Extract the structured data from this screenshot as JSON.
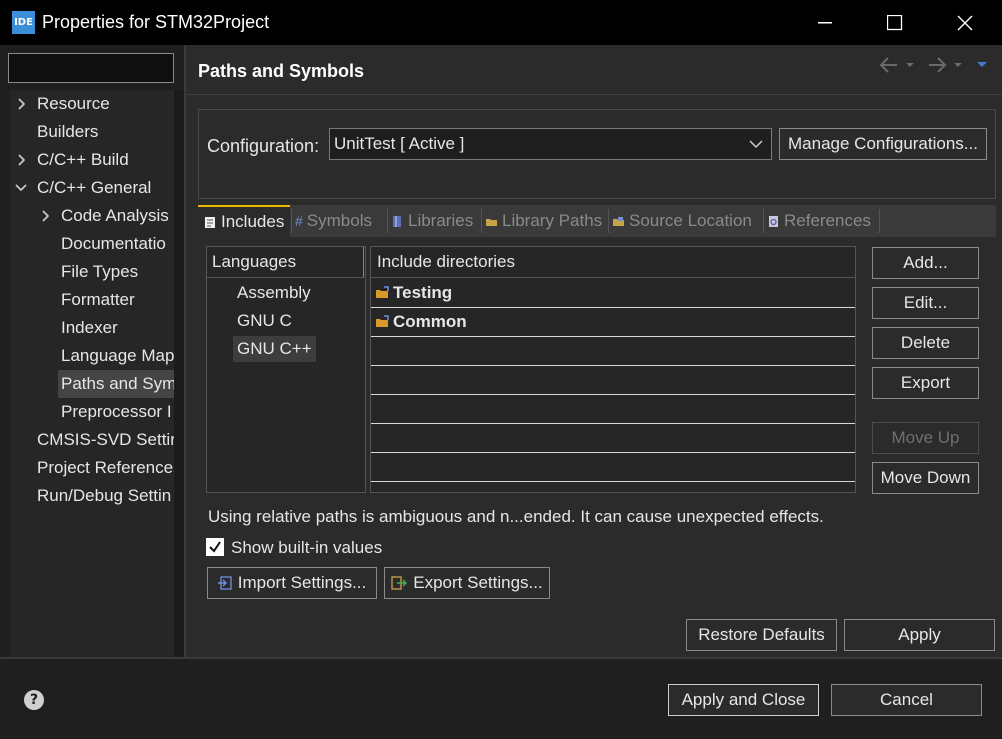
{
  "window": {
    "icon_text": "IDE",
    "title": "Properties for STM32Project"
  },
  "sidebar": {
    "filter_value": "",
    "items": [
      {
        "label": "Resource",
        "expander": "collapsed"
      },
      {
        "label": "Builders",
        "expander": "none"
      },
      {
        "label": "C/C++ Build",
        "expander": "collapsed"
      },
      {
        "label": "C/C++ General",
        "expander": "expanded"
      },
      {
        "label": "Code Analysis",
        "expander": "collapsed"
      },
      {
        "label": "Documentatio",
        "expander": "none"
      },
      {
        "label": "File Types",
        "expander": "none"
      },
      {
        "label": "Formatter",
        "expander": "none"
      },
      {
        "label": "Indexer",
        "expander": "none"
      },
      {
        "label": "Language Map",
        "expander": "none"
      },
      {
        "label": "Paths and Sym",
        "expander": "none",
        "selected": true
      },
      {
        "label": "Preprocessor I",
        "expander": "none"
      },
      {
        "label": "CMSIS-SVD Settir",
        "expander": "none"
      },
      {
        "label": "Project References",
        "expander": "none"
      },
      {
        "label": "Run/Debug Settin",
        "expander": "none"
      }
    ]
  },
  "page": {
    "title": "Paths and Symbols",
    "configuration": {
      "label": "Configuration:",
      "value": "UnitTest  [ Active ]",
      "manage_label": "Manage Configurations..."
    },
    "tabs": [
      {
        "label": "Includes",
        "icon": "includes-icon",
        "active": true
      },
      {
        "label": "Symbols",
        "icon": "symbols-icon"
      },
      {
        "label": "Libraries",
        "icon": "libraries-icon"
      },
      {
        "label": "Library Paths",
        "icon": "library-paths-icon"
      },
      {
        "label": "Source Location",
        "icon": "source-location-icon"
      },
      {
        "label": "References",
        "icon": "references-icon"
      }
    ],
    "languages": {
      "header": "Languages",
      "items": [
        "Assembly",
        "GNU C",
        "GNU C++"
      ],
      "selected": "GNU C++"
    },
    "include_directories": {
      "header": "Include directories",
      "rows": [
        "Testing",
        "Common"
      ]
    },
    "side_buttons": {
      "add": "Add...",
      "edit": "Edit...",
      "delete": "Delete",
      "export": "Export",
      "move_up": "Move Up",
      "move_down": "Move Down"
    },
    "note": "Using relative paths is ambiguous and n...ended. It can cause unexpected effects.",
    "show_builtin": {
      "label": "Show built-in values",
      "checked": true
    },
    "import_settings": "Import Settings...",
    "export_settings": "Export Settings...",
    "restore_defaults": "Restore Defaults",
    "apply": "Apply"
  },
  "footer": {
    "apply_close": "Apply and Close",
    "cancel": "Cancel",
    "help_icon": "?"
  },
  "colors": {
    "accent_tab": "#e8b800",
    "background": "#2b2b2b",
    "titlebar": "#000000"
  }
}
